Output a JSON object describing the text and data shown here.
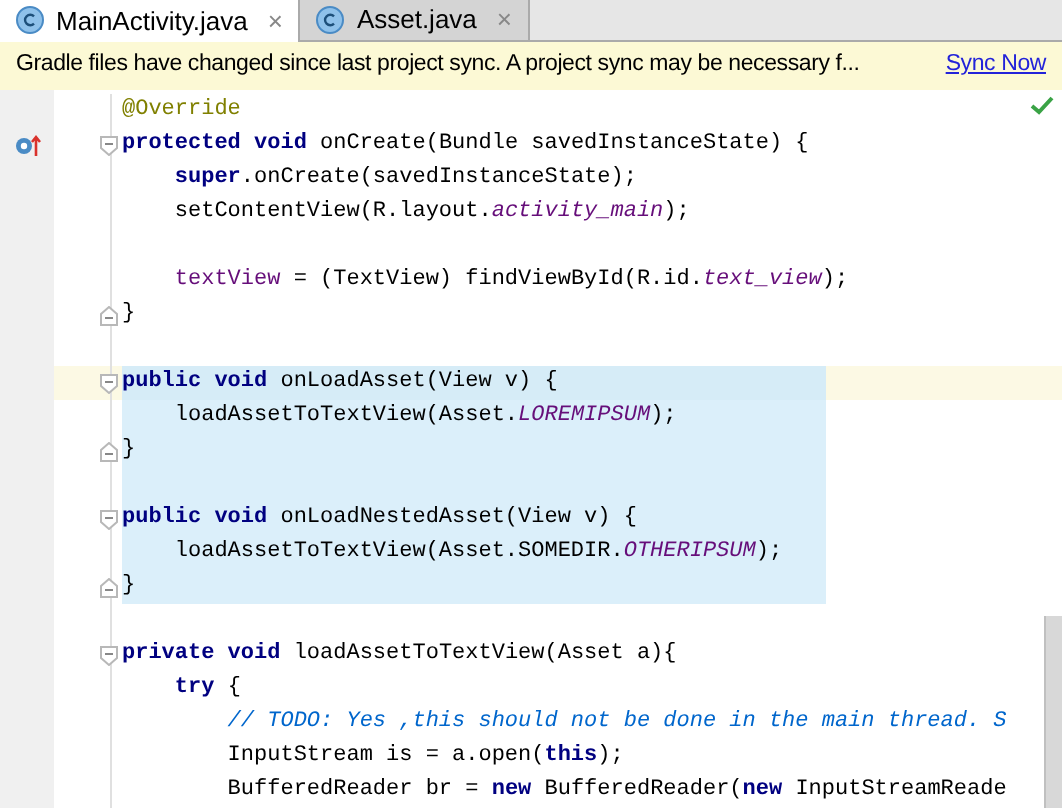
{
  "tabs": [
    {
      "label": "MainActivity.java",
      "close": "×",
      "selected": true
    },
    {
      "label": "Asset.java",
      "close": "×",
      "selected": false
    }
  ],
  "banner": {
    "message": "Gradle files have changed since last project sync. A project sync may be necessary f...",
    "link": "Sync Now"
  },
  "editor": {
    "lines": [
      {
        "kind": "code",
        "highlighted": false,
        "current": false,
        "tokens": [
          {
            "kind": "annotation",
            "text": "@Override"
          }
        ]
      },
      {
        "kind": "code",
        "highlighted": false,
        "current": false,
        "override": true,
        "fold_start": true,
        "tokens": [
          {
            "kind": "kw",
            "text": "protected void "
          },
          {
            "kind": "plain",
            "text": "onCreate(Bundle savedInstanceState) {"
          }
        ]
      },
      {
        "kind": "code",
        "highlighted": false,
        "current": false,
        "tokens": [
          {
            "kind": "kw",
            "text": "    super"
          },
          {
            "kind": "plain",
            "text": ".onCreate(savedInstanceState);"
          }
        ]
      },
      {
        "kind": "code",
        "highlighted": false,
        "current": false,
        "tokens": [
          {
            "kind": "plain",
            "text": "    setContentView(R.layout."
          },
          {
            "kind": "constant",
            "text": "activity_main"
          },
          {
            "kind": "plain",
            "text": ");"
          }
        ]
      },
      {
        "kind": "blank"
      },
      {
        "kind": "code",
        "highlighted": false,
        "current": false,
        "tokens": [
          {
            "kind": "field",
            "text": "    textView"
          },
          {
            "kind": "plain",
            "text": " = (TextView) findViewById(R.id."
          },
          {
            "kind": "constant",
            "text": "text_view"
          },
          {
            "kind": "plain",
            "text": ");"
          }
        ]
      },
      {
        "kind": "code",
        "highlighted": false,
        "current": false,
        "fold_end": true,
        "tokens": [
          {
            "kind": "plain",
            "text": "}"
          }
        ]
      },
      {
        "kind": "blank"
      },
      {
        "kind": "code",
        "highlighted": true,
        "current": true,
        "fold_start": true,
        "tokens": [
          {
            "kind": "kw",
            "text": "public void "
          },
          {
            "kind": "plain",
            "text": "onLoadAsset(View v) {"
          }
        ]
      },
      {
        "kind": "code",
        "highlighted": true,
        "current": false,
        "tokens": [
          {
            "kind": "plain",
            "text": "    loadAssetToTextView(Asset."
          },
          {
            "kind": "constant",
            "text": "LOREMIPSUM"
          },
          {
            "kind": "plain",
            "text": ");"
          }
        ]
      },
      {
        "kind": "code",
        "highlighted": true,
        "current": false,
        "fold_end": true,
        "tokens": [
          {
            "kind": "plain",
            "text": "}"
          }
        ]
      },
      {
        "kind": "blank",
        "highlighted": true,
        "current": false
      },
      {
        "kind": "code",
        "highlighted": true,
        "current": false,
        "fold_start": true,
        "tokens": [
          {
            "kind": "kw",
            "text": "public void "
          },
          {
            "kind": "plain",
            "text": "onLoadNestedAsset(View v) {"
          }
        ]
      },
      {
        "kind": "code",
        "highlighted": true,
        "current": false,
        "tokens": [
          {
            "kind": "plain",
            "text": "    loadAssetToTextView(Asset.SOMEDIR."
          },
          {
            "kind": "constant",
            "text": "OTHERIPSUM"
          },
          {
            "kind": "plain",
            "text": ");"
          }
        ]
      },
      {
        "kind": "code",
        "highlighted": true,
        "current": false,
        "fold_end": true,
        "tokens": [
          {
            "kind": "plain",
            "text": "}"
          }
        ]
      },
      {
        "kind": "blank"
      },
      {
        "kind": "code",
        "highlighted": false,
        "current": false,
        "fold_start": true,
        "tokens": [
          {
            "kind": "kw",
            "text": "private void "
          },
          {
            "kind": "plain",
            "text": "loadAssetToTextView(Asset a){"
          }
        ]
      },
      {
        "kind": "code",
        "highlighted": false,
        "current": false,
        "tokens": [
          {
            "kind": "kw",
            "text": "    try"
          },
          {
            "kind": "plain",
            "text": " {"
          }
        ]
      },
      {
        "kind": "code",
        "highlighted": false,
        "current": false,
        "tokens": [
          {
            "kind": "comment",
            "text": "        // TODO: Yes ,this should not be done in the main thread. S"
          }
        ]
      },
      {
        "kind": "code",
        "highlighted": false,
        "current": false,
        "tokens": [
          {
            "kind": "plain",
            "text": "        InputStream is = a.open("
          },
          {
            "kind": "kw",
            "text": "this"
          },
          {
            "kind": "plain",
            "text": ");"
          }
        ]
      },
      {
        "kind": "code",
        "highlighted": false,
        "current": false,
        "tokens": [
          {
            "kind": "plain",
            "text": "        BufferedReader br = "
          },
          {
            "kind": "kw",
            "text": "new"
          },
          {
            "kind": "plain",
            "text": " BufferedReader("
          },
          {
            "kind": "kw",
            "text": "new"
          },
          {
            "kind": "plain",
            "text": " InputStreamReade"
          }
        ]
      }
    ]
  }
}
